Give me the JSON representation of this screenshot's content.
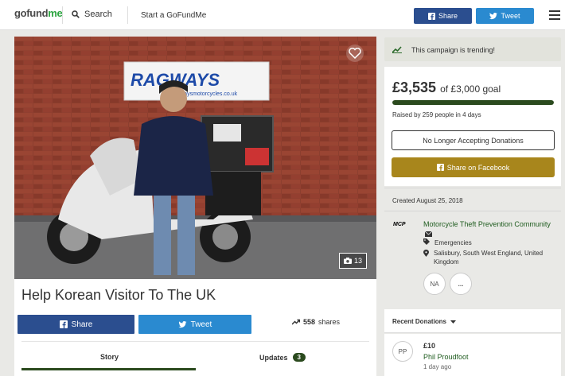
{
  "header": {
    "logo_text_main": "gofund",
    "logo_text_accent": "me",
    "search_label": "Search",
    "start_label": "Start a GoFundMe",
    "share_label": "Share",
    "tweet_label": "Tweet"
  },
  "photo": {
    "sign_text": "RAGWAYS",
    "sign_url": "ragwaysmotorcycles.co.uk",
    "photo_count": "13"
  },
  "campaign": {
    "title": "Help Korean Visitor To The UK",
    "share_label": "Share",
    "tweet_label": "Tweet",
    "shares_count": "558",
    "shares_suffix": "shares",
    "tabs": {
      "story": "Story",
      "updates": "Updates",
      "updates_count": "3"
    }
  },
  "sidebar": {
    "trending_text": "This campaign is trending!",
    "amount_raised": "£3,535",
    "goal_text": "of £3,000 goal",
    "progress_fraction": 1.0,
    "raised_by": "Raised by 259 people in 4 days",
    "no_longer_label": "No Longer Accepting Donations",
    "share_fb_label": "Share on Facebook",
    "created": "Created August 25, 2018",
    "organizer": {
      "logo_text": "MCP",
      "name": "Motorcycle Theft Prevention Community",
      "category": "Emergencies",
      "location": "Salisbury, South West England, United Kingdom",
      "avatar_initials": "NA",
      "more_label": "..."
    },
    "recent_donations_label": "Recent Donations",
    "donation": {
      "initials": "PP",
      "amount": "£10",
      "name": "Phil Proudfoot",
      "time": "1 day ago"
    }
  },
  "colors": {
    "brand_green": "#2b4a1e",
    "facebook_blue": "#2b4e8f",
    "twitter_blue": "#2a8ad0",
    "gold_button": "#a8861c"
  }
}
